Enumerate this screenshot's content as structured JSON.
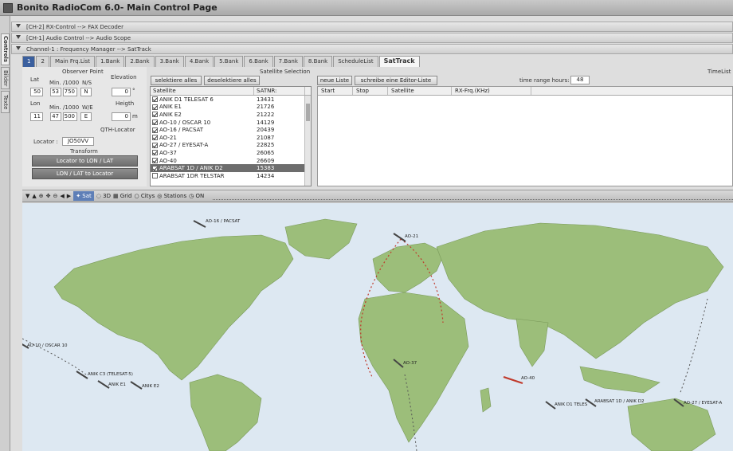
{
  "window": {
    "title": "Bonito RadioCom 6.0- Main Control Page"
  },
  "side_tabs": [
    "Controls",
    "Bilder",
    "Texte"
  ],
  "channels": [
    "[CH-2] RX-Control --> FAX Decoder",
    "[CH-1] Audio Control --> Audio Scope",
    "Channel-1 : Frequency Manager --> SatTrack"
  ],
  "tabs": [
    "1",
    "2",
    "Main Frq.List",
    "1.Bank",
    "2.Bank",
    "3.Bank",
    "4.Bank",
    "5.Bank",
    "6.Bank",
    "7.Bank",
    "8.Bank",
    "ScheduleList",
    "SatTrack"
  ],
  "observer": {
    "title": "Observer Point",
    "lat_label": "Lat",
    "min_label": "Min.",
    "frac_label": "/1000",
    "ns_label": "N/S",
    "lat_deg": "50",
    "lat_min": "53",
    "lat_frac": "750",
    "lat_ns": "N",
    "lon_label": "Lon",
    "we_label": "W/E",
    "lon_deg": "11",
    "lon_min": "47",
    "lon_frac": "500",
    "lon_we": "E",
    "elevation_label": "Elevation",
    "elevation_value": "0",
    "elevation_unit": "°",
    "height_label": "Heigth",
    "height_value": "0",
    "height_unit": "m",
    "qth_label": "QTH-Locator",
    "locator_label": "Locator :",
    "locator_value": "JO50VV",
    "transform_label": "Transform",
    "btn_loc_to_lonlat": "Locator to LON / LAT",
    "btn_lonlat_to_loc": "LON / LAT to Locator"
  },
  "satellite_selection": {
    "title": "Satellite Selection",
    "select_all": "selektiere alles",
    "deselect_all": "deselektiere alles",
    "col_satellite": "Satellite",
    "col_satnr": "SATNR:",
    "rows": [
      {
        "name": "ANIK D1 TELESAT 6",
        "nr": "13431",
        "checked": true
      },
      {
        "name": "ANIK E1",
        "nr": "21726",
        "checked": true
      },
      {
        "name": "ANIK E2",
        "nr": "21222",
        "checked": true
      },
      {
        "name": "AO-10 / OSCAR 10",
        "nr": "14129",
        "checked": true
      },
      {
        "name": "AO-16 / PACSAT",
        "nr": "20439",
        "checked": true
      },
      {
        "name": "AO-21",
        "nr": "21087",
        "checked": true
      },
      {
        "name": "AO-27 / EYESAT-A",
        "nr": "22825",
        "checked": true
      },
      {
        "name": "AO-37",
        "nr": "26065",
        "checked": true
      },
      {
        "name": "AO-40",
        "nr": "26609",
        "checked": true
      },
      {
        "name": "ARABSAT 1D / ANIK D2",
        "nr": "15383",
        "checked": true,
        "selected": true
      },
      {
        "name": "ARABSAT 1DR TELSTAR",
        "nr": "14234",
        "checked": false
      }
    ]
  },
  "timelist": {
    "title": "TimeList",
    "new_list": "neue Liste",
    "write_editor": "schreibe eine Editor-Liste",
    "range_label": "time range hours:",
    "range_value": "48",
    "columns": [
      "Start",
      "Stop",
      "Satellite",
      "RX-Frq.(KHz)"
    ]
  },
  "map_toolbar": [
    "Sat",
    "3D",
    "Grid",
    "Citys",
    "Stations",
    "ON"
  ],
  "map_labels": {
    "ao16": "AO-16 / PACSAT",
    "ao21": "AO-21",
    "ao10": "AO-10 / OSCAR 10",
    "anikc3": "ANIK C3 (TELESAT-5)",
    "anike1": "ANIK E1",
    "anike2": "ANIK E2",
    "ao37": "AO-37",
    "ao40": "AO-40",
    "anikd1": "ANIK D1 TELES",
    "arabsat": "ARABSAT 1D / ANIK D2",
    "ao27": "AO-27 / EYESAT-A"
  },
  "colors": {
    "land": "#9cbe7a",
    "ocean": "#dde8f2",
    "track": "#c0392b",
    "selected_row": "#6d6d6d"
  }
}
